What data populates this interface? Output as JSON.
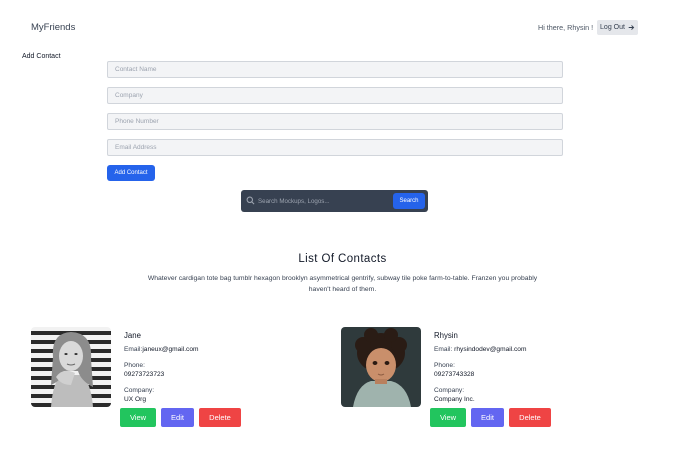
{
  "header": {
    "brand": "MyFriends",
    "greeting": "Hi there, Rhysin !",
    "logout_label": "Log Out"
  },
  "form": {
    "section_label": "Add Contact",
    "name_placeholder": "Contact Name",
    "company_placeholder": "Company",
    "phone_placeholder": "Phone Number",
    "email_placeholder": "Email Address",
    "submit_label": "Add Contact"
  },
  "search": {
    "placeholder": "Search Mockups, Logos...",
    "button_label": "Search"
  },
  "list": {
    "title": "List Of Contacts",
    "description": "Whatever cardigan tote bag tumblr hexagon brooklyn asymmetrical gentrify, subway tile poke farm-to-table. Franzen you probably haven't heard of them.",
    "email_prefix": "Email:",
    "phone_label": "Phone:",
    "company_label": "Company:",
    "view_label": "View",
    "edit_label": "Edit",
    "delete_label": "Delete",
    "contacts": [
      {
        "name": "Jane",
        "email": "janeux@gmail.com",
        "phone": "09273723723",
        "company": "UX Org"
      },
      {
        "name": "Rhysin",
        "email": "rhysindodev@gmail.com",
        "phone": "09273743328",
        "company": "Company Inc."
      }
    ]
  },
  "colors": {
    "primary": "#2563eb",
    "view": "#22c55e",
    "edit": "#6366f1",
    "delete": "#ef4444",
    "search_bg": "#374151"
  }
}
